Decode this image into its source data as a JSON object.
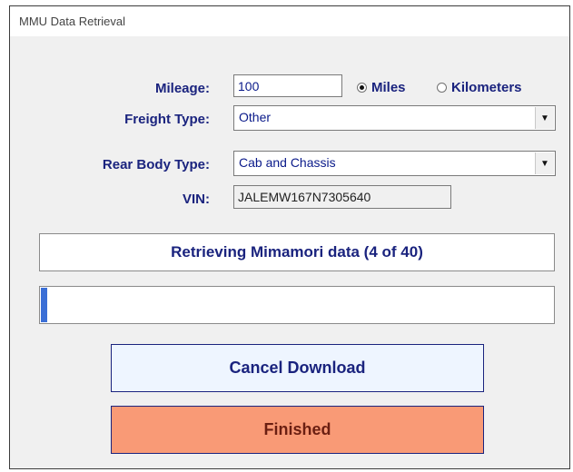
{
  "window": {
    "title": "MMU Data Retrieval"
  },
  "form": {
    "mileage_label": "Mileage:",
    "mileage_value": "100",
    "units": [
      {
        "label": "Miles",
        "checked": true
      },
      {
        "label": "Kilometers",
        "checked": false
      }
    ],
    "freight_label": "Freight Type:",
    "freight_value": "Other",
    "rear_body_label": "Rear Body Type:",
    "rear_body_value": "Cab and Chassis",
    "vin_label": "VIN:",
    "vin_value": "JALEMW167N7305640"
  },
  "status": {
    "text": "Retrieving Mimamori data (4 of 40)"
  },
  "progress": {
    "fraction": 0.013
  },
  "buttons": {
    "cancel_label": "Cancel Download",
    "finished_label": "Finished"
  },
  "colors": {
    "progress_fill": "#3b6fd6",
    "finished_bg": "#f99a76",
    "cancel_bg": "#eef5ff",
    "label": "#1a237e"
  },
  "icons": {
    "dropdown": "chevron-down-icon"
  }
}
